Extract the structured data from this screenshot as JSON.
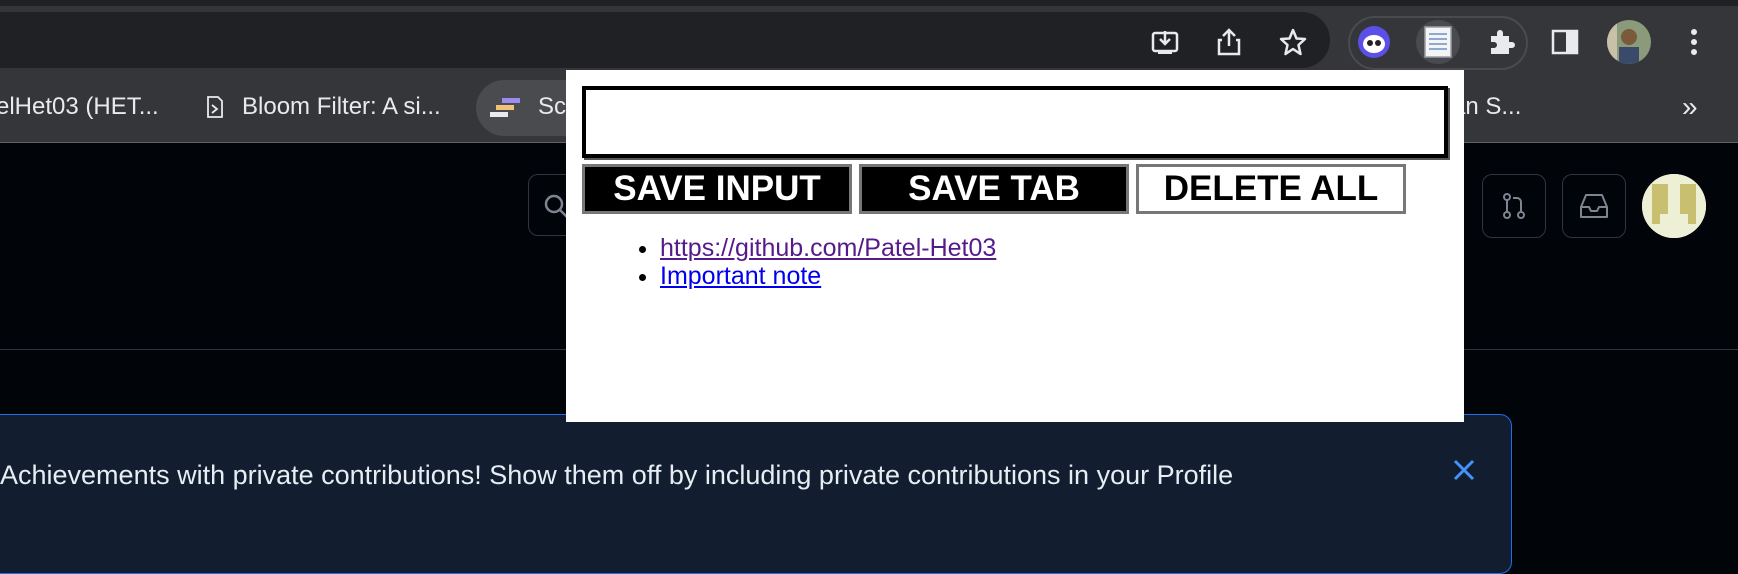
{
  "browser": {
    "bookmarks": [
      {
        "label": "elHet03 (HET..."
      },
      {
        "label": "Bloom Filter: A si..."
      },
      {
        "label": "Sc"
      },
      {
        "label": "an S..."
      }
    ],
    "overflow_label": "»",
    "toolbar_icons": [
      "install-icon",
      "share-icon",
      "star-icon",
      "extension-blue-icon",
      "notepad-icon",
      "puzzle-icon",
      "sidepanel-icon",
      "avatar",
      "menu-icon"
    ]
  },
  "banner": {
    "text": "Achievements with private contributions! Show them off by including private contributions in your Profile"
  },
  "popup": {
    "input_value": "",
    "buttons": {
      "save_input": "SAVE INPUT",
      "save_tab": "SAVE TAB",
      "delete_all": "DELETE ALL"
    },
    "leads": [
      {
        "text": "https://github.com/Patel-Het03",
        "visited": true
      },
      {
        "text": "Important note",
        "visited": false
      }
    ]
  },
  "colors": {
    "chrome_bg": "#35363a",
    "page_bg": "#010409",
    "banner_bg": "#121d2f",
    "banner_border": "#1f6feb",
    "link_visited": "#551a8b",
    "link_unvisited": "#0000ee"
  }
}
